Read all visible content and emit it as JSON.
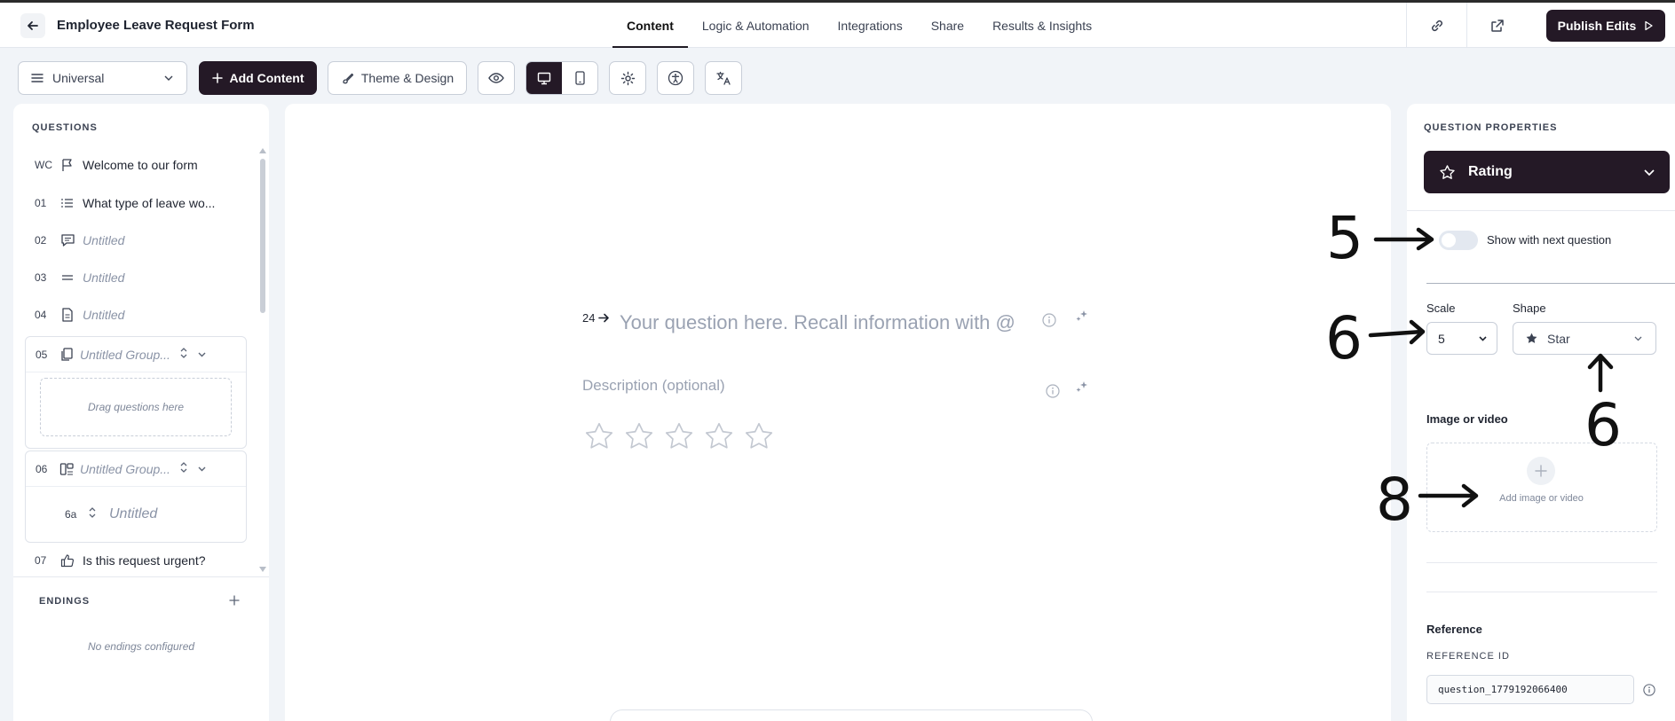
{
  "header": {
    "title": "Employee Leave Request Form",
    "tabs": [
      "Content",
      "Logic & Automation",
      "Integrations",
      "Share",
      "Results & Insights"
    ],
    "publish_label": "Publish Edits"
  },
  "toolbar": {
    "view_select": "Universal",
    "add_content": "Add Content",
    "theme": "Theme & Design"
  },
  "questions_panel": {
    "title": "QUESTIONS",
    "items": [
      {
        "num": "WC",
        "text": "Welcome to our form"
      },
      {
        "num": "01",
        "text": "What type of leave wo..."
      },
      {
        "num": "02",
        "text": "Untitled"
      },
      {
        "num": "03",
        "text": "Untitled"
      },
      {
        "num": "04",
        "text": "Untitled"
      },
      {
        "num": "05",
        "text": "Untitled Group..."
      },
      {
        "num": "06",
        "text": "Untitled Group..."
      },
      {
        "num": "6a",
        "text": "Untitled"
      },
      {
        "num": "07",
        "text": "Is this request urgent?"
      }
    ],
    "drag_hint": "Drag questions here",
    "endings_title": "ENDINGS",
    "no_endings": "No endings configured"
  },
  "editor": {
    "question_number": "24",
    "question_placeholder": "Your question here. Recall information with @",
    "description_placeholder": "Description (optional)",
    "star_count": 5
  },
  "properties": {
    "title": "QUESTION PROPERTIES",
    "type": "Rating",
    "show_with_next": "Show with next question",
    "scale_label": "Scale",
    "scale_value": "5",
    "shape_label": "Shape",
    "shape_value": "Star",
    "media_label": "Image or video",
    "add_media": "Add image or video",
    "reference_title": "Reference",
    "reference_id_label": "REFERENCE ID",
    "reference_id": "question_1779192066400"
  },
  "annotations": {
    "a1": "5",
    "a2": "6",
    "a3": "6",
    "a4": "8"
  }
}
